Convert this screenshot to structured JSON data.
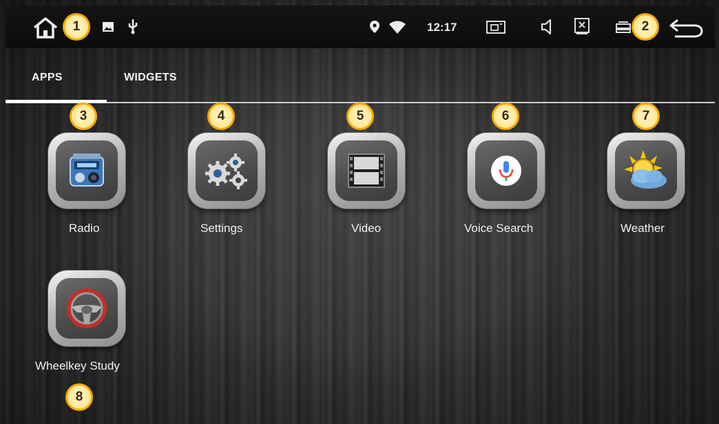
{
  "status_bar": {
    "time": "12:17"
  },
  "tabs": [
    {
      "label": "APPS",
      "active": true
    },
    {
      "label": "WIDGETS",
      "active": false
    }
  ],
  "apps": [
    {
      "label": "Radio",
      "icon": "radio-icon",
      "badge": "3"
    },
    {
      "label": "Settings",
      "icon": "gears-icon",
      "badge": "4"
    },
    {
      "label": "Video",
      "icon": "film-icon",
      "badge": "5"
    },
    {
      "label": "Voice Search",
      "icon": "microphone-icon",
      "badge": "6"
    },
    {
      "label": "Weather",
      "icon": "sun-cloud-icon",
      "badge": "7"
    },
    {
      "label": "Wheelkey Study",
      "icon": "steering-wheel-icon",
      "badge": "8"
    }
  ],
  "callouts": {
    "home": "1",
    "back": "2"
  },
  "colors": {
    "badge_border": "#f5a800",
    "badge_fill": "#ffe27a",
    "status_bar": "#0c0c0c",
    "tab_indicator": "#ffffff"
  }
}
